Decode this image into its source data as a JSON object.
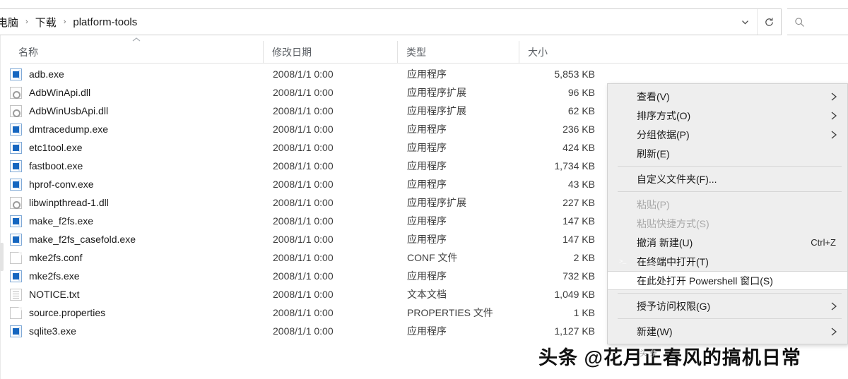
{
  "window": {
    "breadcrumb": {
      "items": [
        "电脑",
        "下载",
        "platform-tools"
      ],
      "separator": "›"
    },
    "dropdown_icon": "chevron-down-icon",
    "refresh_icon": "refresh-icon",
    "search_icon": "search-icon"
  },
  "columns": [
    {
      "label": "名称"
    },
    {
      "label": "修改日期"
    },
    {
      "label": "类型"
    },
    {
      "label": "大小"
    }
  ],
  "sort_indicator": "⌃",
  "files": [
    {
      "name": "adb.exe",
      "date": "2008/1/1 0:00",
      "type": "应用程序",
      "size": "5,853 KB",
      "icon": "exe"
    },
    {
      "name": "AdbWinApi.dll",
      "date": "2008/1/1 0:00",
      "type": "应用程序扩展",
      "size": "96 KB",
      "icon": "dll"
    },
    {
      "name": "AdbWinUsbApi.dll",
      "date": "2008/1/1 0:00",
      "type": "应用程序扩展",
      "size": "62 KB",
      "icon": "dll"
    },
    {
      "name": "dmtracedump.exe",
      "date": "2008/1/1 0:00",
      "type": "应用程序",
      "size": "236 KB",
      "icon": "exe"
    },
    {
      "name": "etc1tool.exe",
      "date": "2008/1/1 0:00",
      "type": "应用程序",
      "size": "424 KB",
      "icon": "exe"
    },
    {
      "name": "fastboot.exe",
      "date": "2008/1/1 0:00",
      "type": "应用程序",
      "size": "1,734 KB",
      "icon": "exe"
    },
    {
      "name": "hprof-conv.exe",
      "date": "2008/1/1 0:00",
      "type": "应用程序",
      "size": "43 KB",
      "icon": "exe"
    },
    {
      "name": "libwinpthread-1.dll",
      "date": "2008/1/1 0:00",
      "type": "应用程序扩展",
      "size": "227 KB",
      "icon": "dll"
    },
    {
      "name": "make_f2fs.exe",
      "date": "2008/1/1 0:00",
      "type": "应用程序",
      "size": "147 KB",
      "icon": "exe"
    },
    {
      "name": "make_f2fs_casefold.exe",
      "date": "2008/1/1 0:00",
      "type": "应用程序",
      "size": "147 KB",
      "icon": "exe"
    },
    {
      "name": "mke2fs.conf",
      "date": "2008/1/1 0:00",
      "type": "CONF 文件",
      "size": "2 KB",
      "icon": "doc"
    },
    {
      "name": "mke2fs.exe",
      "date": "2008/1/1 0:00",
      "type": "应用程序",
      "size": "732 KB",
      "icon": "exe"
    },
    {
      "name": "NOTICE.txt",
      "date": "2008/1/1 0:00",
      "type": "文本文档",
      "size": "1,049 KB",
      "icon": "txt"
    },
    {
      "name": "source.properties",
      "date": "2008/1/1 0:00",
      "type": "PROPERTIES 文件",
      "size": "1 KB",
      "icon": "doc"
    },
    {
      "name": "sqlite3.exe",
      "date": "2008/1/1 0:00",
      "type": "应用程序",
      "size": "1,127 KB",
      "icon": "exe"
    }
  ],
  "context_menu": {
    "items": [
      {
        "label": "查看(V)",
        "submenu": true,
        "disabled": false,
        "highlight": false,
        "icon": null,
        "shortcut": ""
      },
      {
        "label": "排序方式(O)",
        "submenu": true,
        "disabled": false,
        "highlight": false,
        "icon": null,
        "shortcut": ""
      },
      {
        "label": "分组依据(P)",
        "submenu": true,
        "disabled": false,
        "highlight": false,
        "icon": null,
        "shortcut": ""
      },
      {
        "label": "刷新(E)",
        "submenu": false,
        "disabled": false,
        "highlight": false,
        "icon": null,
        "shortcut": ""
      },
      {
        "separator": true
      },
      {
        "label": "自定义文件夹(F)...",
        "submenu": false,
        "disabled": false,
        "highlight": false,
        "icon": null,
        "shortcut": ""
      },
      {
        "separator": true
      },
      {
        "label": "粘贴(P)",
        "submenu": false,
        "disabled": true,
        "highlight": false,
        "icon": null,
        "shortcut": ""
      },
      {
        "label": "粘贴快捷方式(S)",
        "submenu": false,
        "disabled": true,
        "highlight": false,
        "icon": null,
        "shortcut": ""
      },
      {
        "label": "撤消 新建(U)",
        "submenu": false,
        "disabled": false,
        "highlight": false,
        "icon": null,
        "shortcut": "Ctrl+Z"
      },
      {
        "label": "在终端中打开(T)",
        "submenu": false,
        "disabled": false,
        "highlight": false,
        "icon": "terminal-icon",
        "shortcut": ""
      },
      {
        "label": "在此处打开 Powershell 窗口(S)",
        "submenu": false,
        "disabled": false,
        "highlight": true,
        "icon": null,
        "shortcut": ""
      },
      {
        "separator": true
      },
      {
        "label": "授予访问权限(G)",
        "submenu": true,
        "disabled": false,
        "highlight": false,
        "icon": null,
        "shortcut": ""
      },
      {
        "separator": true
      },
      {
        "label": "新建(W)",
        "submenu": true,
        "disabled": false,
        "highlight": false,
        "icon": null,
        "shortcut": ""
      }
    ],
    "arrow_glyph": "›"
  },
  "watermark": {
    "text": "头条 @花月正春风的搞机日常",
    "sub": "头条"
  },
  "colors": {
    "menu_bg": "#eeeeee",
    "menu_highlight": "#ffffff",
    "exe_icon": "#1566c0",
    "text": "#1b1b1b",
    "disabled_text": "#a9a9a9",
    "header_text": "#5a5e63"
  }
}
